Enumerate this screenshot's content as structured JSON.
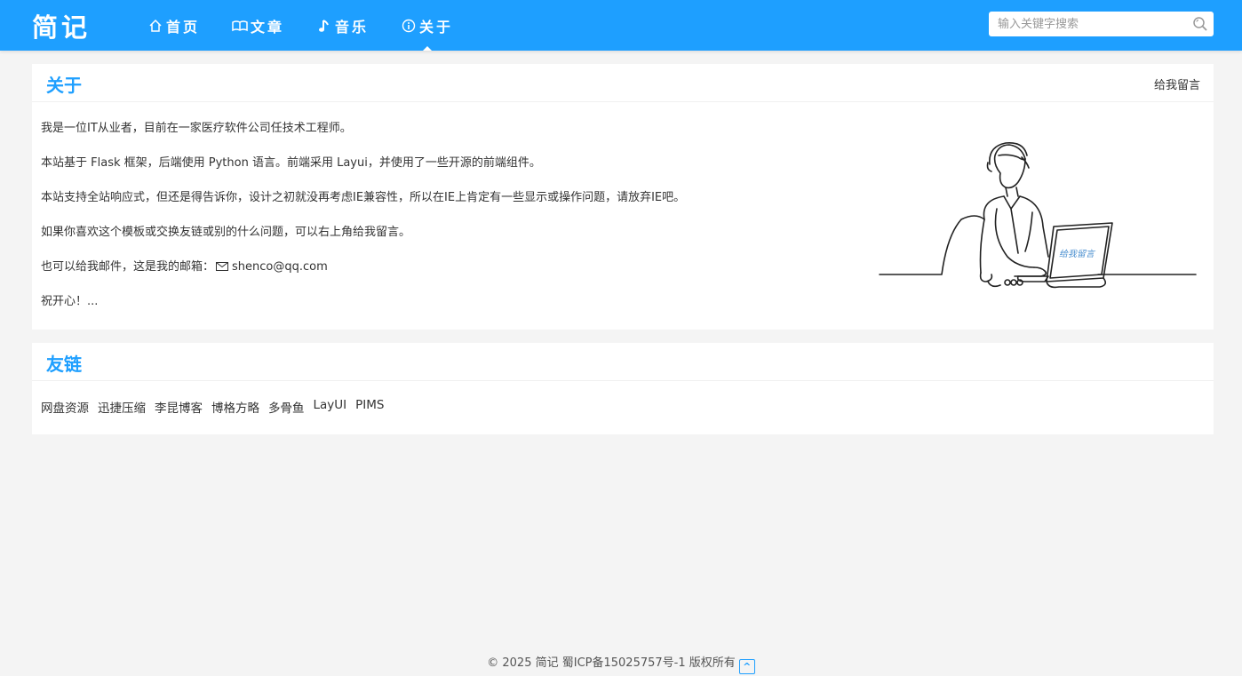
{
  "header": {
    "logo": "简记",
    "nav": [
      {
        "label": "首页",
        "icon": "home-icon"
      },
      {
        "label": "文章",
        "icon": "book-icon"
      },
      {
        "label": "音乐",
        "icon": "music-note-icon"
      },
      {
        "label": "关于",
        "icon": "info-icon",
        "active": true
      }
    ],
    "search_placeholder": "输入关键字搜索",
    "search_value": ""
  },
  "about": {
    "title": "关于",
    "action": "给我留言",
    "paragraphs": [
      "我是一位IT从业者，目前在一家医疗软件公司任技术工程师。",
      "本站基于 Flask 框架，后端使用 Python 语言。前端采用 Layui，并使用了一些开源的前端组件。",
      "本站支持全站响应式，但还是得告诉你，设计之初就没再考虑IE兼容性，所以在IE上肯定有一些显示或操作问题，请放弃IE吧。",
      "如果你喜欢这个模板或交换友链或别的什么问题，可以右上角给我留言。"
    ],
    "email_prefix": "也可以给我邮件，这是我的邮箱：",
    "email": "shenco@qq.com",
    "closing": "祝开心！...",
    "illustration_label": "给我留言"
  },
  "links": {
    "title": "友链",
    "items": [
      "网盘资源",
      "迅捷压缩",
      "李昆博客",
      "博格方略",
      "多骨鱼",
      "LayUI",
      "PIMS"
    ]
  },
  "footer": {
    "text": "© 2025 简记 蜀ICP备15025757号-1 版权所有",
    "top_icon": "caret-up-icon"
  },
  "colors": {
    "accent": "#1e9fff",
    "background": "#f4f4f4"
  }
}
